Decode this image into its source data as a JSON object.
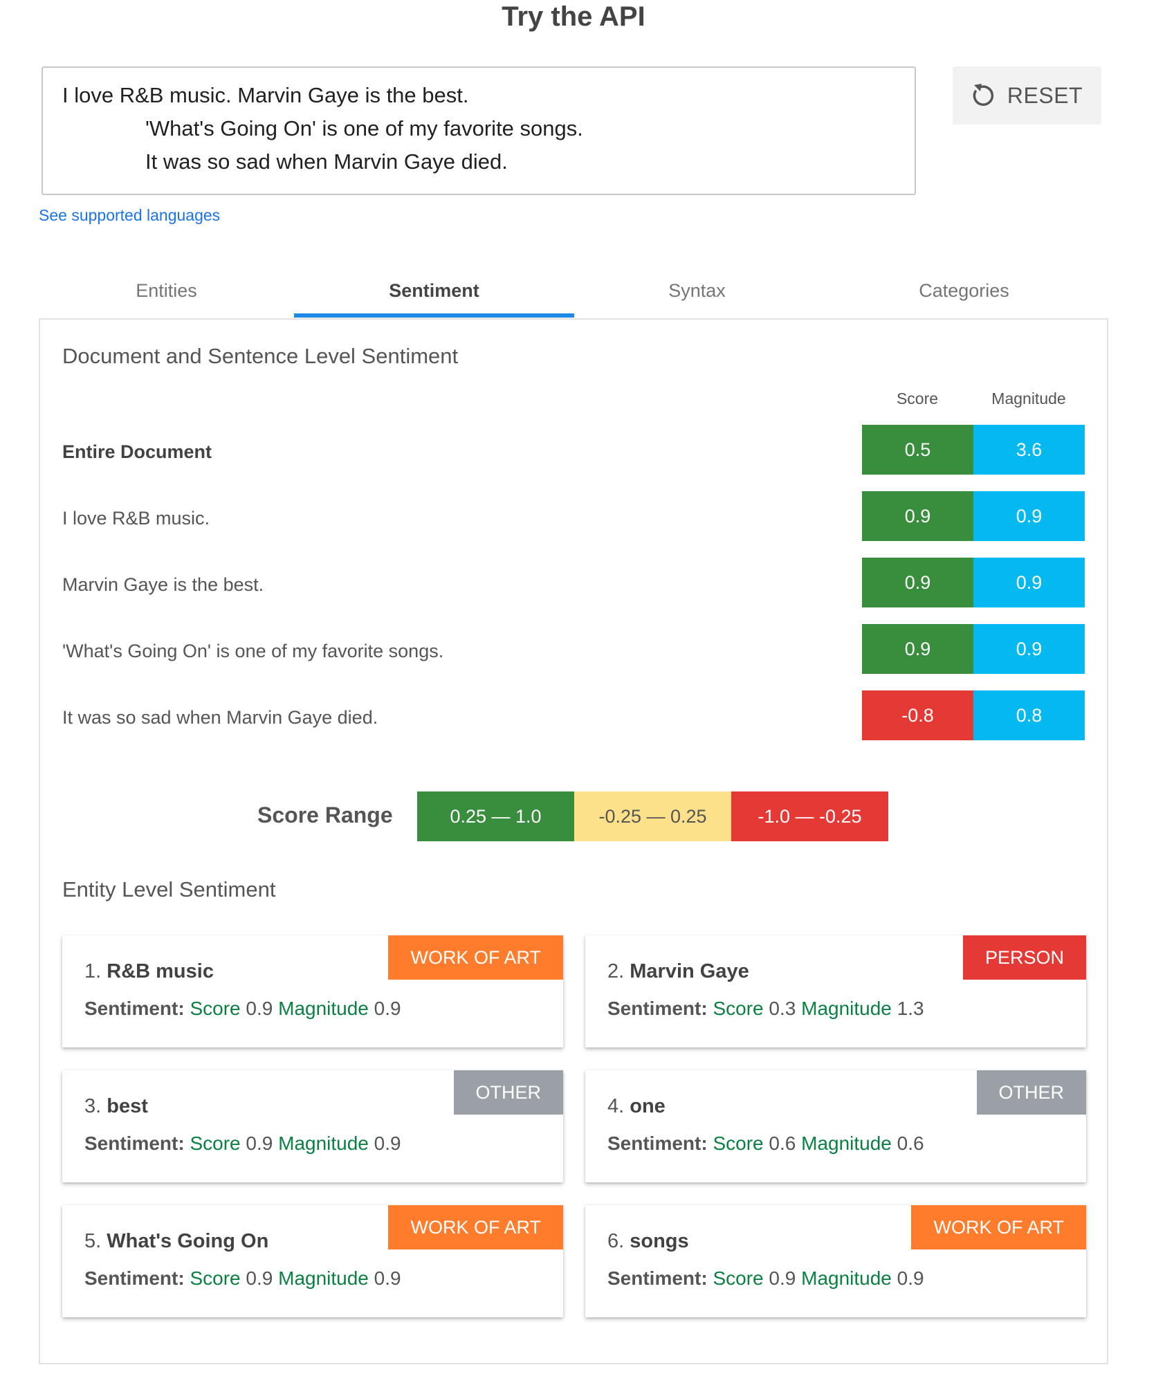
{
  "page": {
    "title": "Try the API"
  },
  "input": {
    "lines": [
      "I love R&B music. Marvin Gaye is the best.",
      "'What's Going On' is one of my favorite songs.",
      "It was so sad when Marvin Gaye died."
    ]
  },
  "reset": {
    "label": "RESET",
    "icon": "refresh-icon"
  },
  "languages_link": "See supported languages",
  "tabs": [
    {
      "label": "Entities",
      "active": false
    },
    {
      "label": "Sentiment",
      "active": true
    },
    {
      "label": "Syntax",
      "active": false
    },
    {
      "label": "Categories",
      "active": false
    }
  ],
  "document_sentiment": {
    "title": "Document and Sentence Level Sentiment",
    "score_header": "Score",
    "magnitude_header": "Magnitude",
    "rows": [
      {
        "label": "Entire Document",
        "score": "0.5",
        "magnitude": "3.6",
        "score_color": "#388e3c"
      },
      {
        "label": "I love R&B music.",
        "score": "0.9",
        "magnitude": "0.9",
        "score_color": "#388e3c"
      },
      {
        "label": "Marvin Gaye is the best.",
        "score": "0.9",
        "magnitude": "0.9",
        "score_color": "#388e3c"
      },
      {
        "label": "'What's Going On' is one of my favorite songs.",
        "score": "0.9",
        "magnitude": "0.9",
        "score_color": "#388e3c"
      },
      {
        "label": "It was so sad when Marvin Gaye died.",
        "score": "-0.8",
        "magnitude": "0.8",
        "score_color": "#e53935"
      }
    ],
    "magnitude_color": "#03b9ef"
  },
  "score_range": {
    "label": "Score Range",
    "ranges": [
      {
        "label": "0.25 — 1.0",
        "color": "#388e3c"
      },
      {
        "label": "-0.25 — 0.25",
        "color": "#fce18a"
      },
      {
        "label": "-1.0 — -0.25",
        "color": "#e53935"
      }
    ]
  },
  "entity_sentiment": {
    "title": "Entity Level Sentiment",
    "sentiment_label": "Sentiment:",
    "score_label": "Score",
    "magnitude_label": "Magnitude",
    "entities": [
      {
        "index": "1.",
        "name": "R&B music",
        "type": "WORK OF ART",
        "type_color": "#ff7c2c",
        "score": "0.9",
        "magnitude": "0.9"
      },
      {
        "index": "2.",
        "name": "Marvin Gaye",
        "type": "PERSON",
        "type_color": "#e53935",
        "score": "0.3",
        "magnitude": "1.3"
      },
      {
        "index": "3.",
        "name": "best",
        "type": "OTHER",
        "type_color": "#9aa0a6",
        "score": "0.9",
        "magnitude": "0.9"
      },
      {
        "index": "4.",
        "name": "one",
        "type": "OTHER",
        "type_color": "#9aa0a6",
        "score": "0.6",
        "magnitude": "0.6"
      },
      {
        "index": "5.",
        "name": "What's Going On",
        "type": "WORK OF ART",
        "type_color": "#ff7c2c",
        "score": "0.9",
        "magnitude": "0.9"
      },
      {
        "index": "6.",
        "name": "songs",
        "type": "WORK OF ART",
        "type_color": "#ff7c2c",
        "score": "0.9",
        "magnitude": "0.9"
      }
    ]
  }
}
